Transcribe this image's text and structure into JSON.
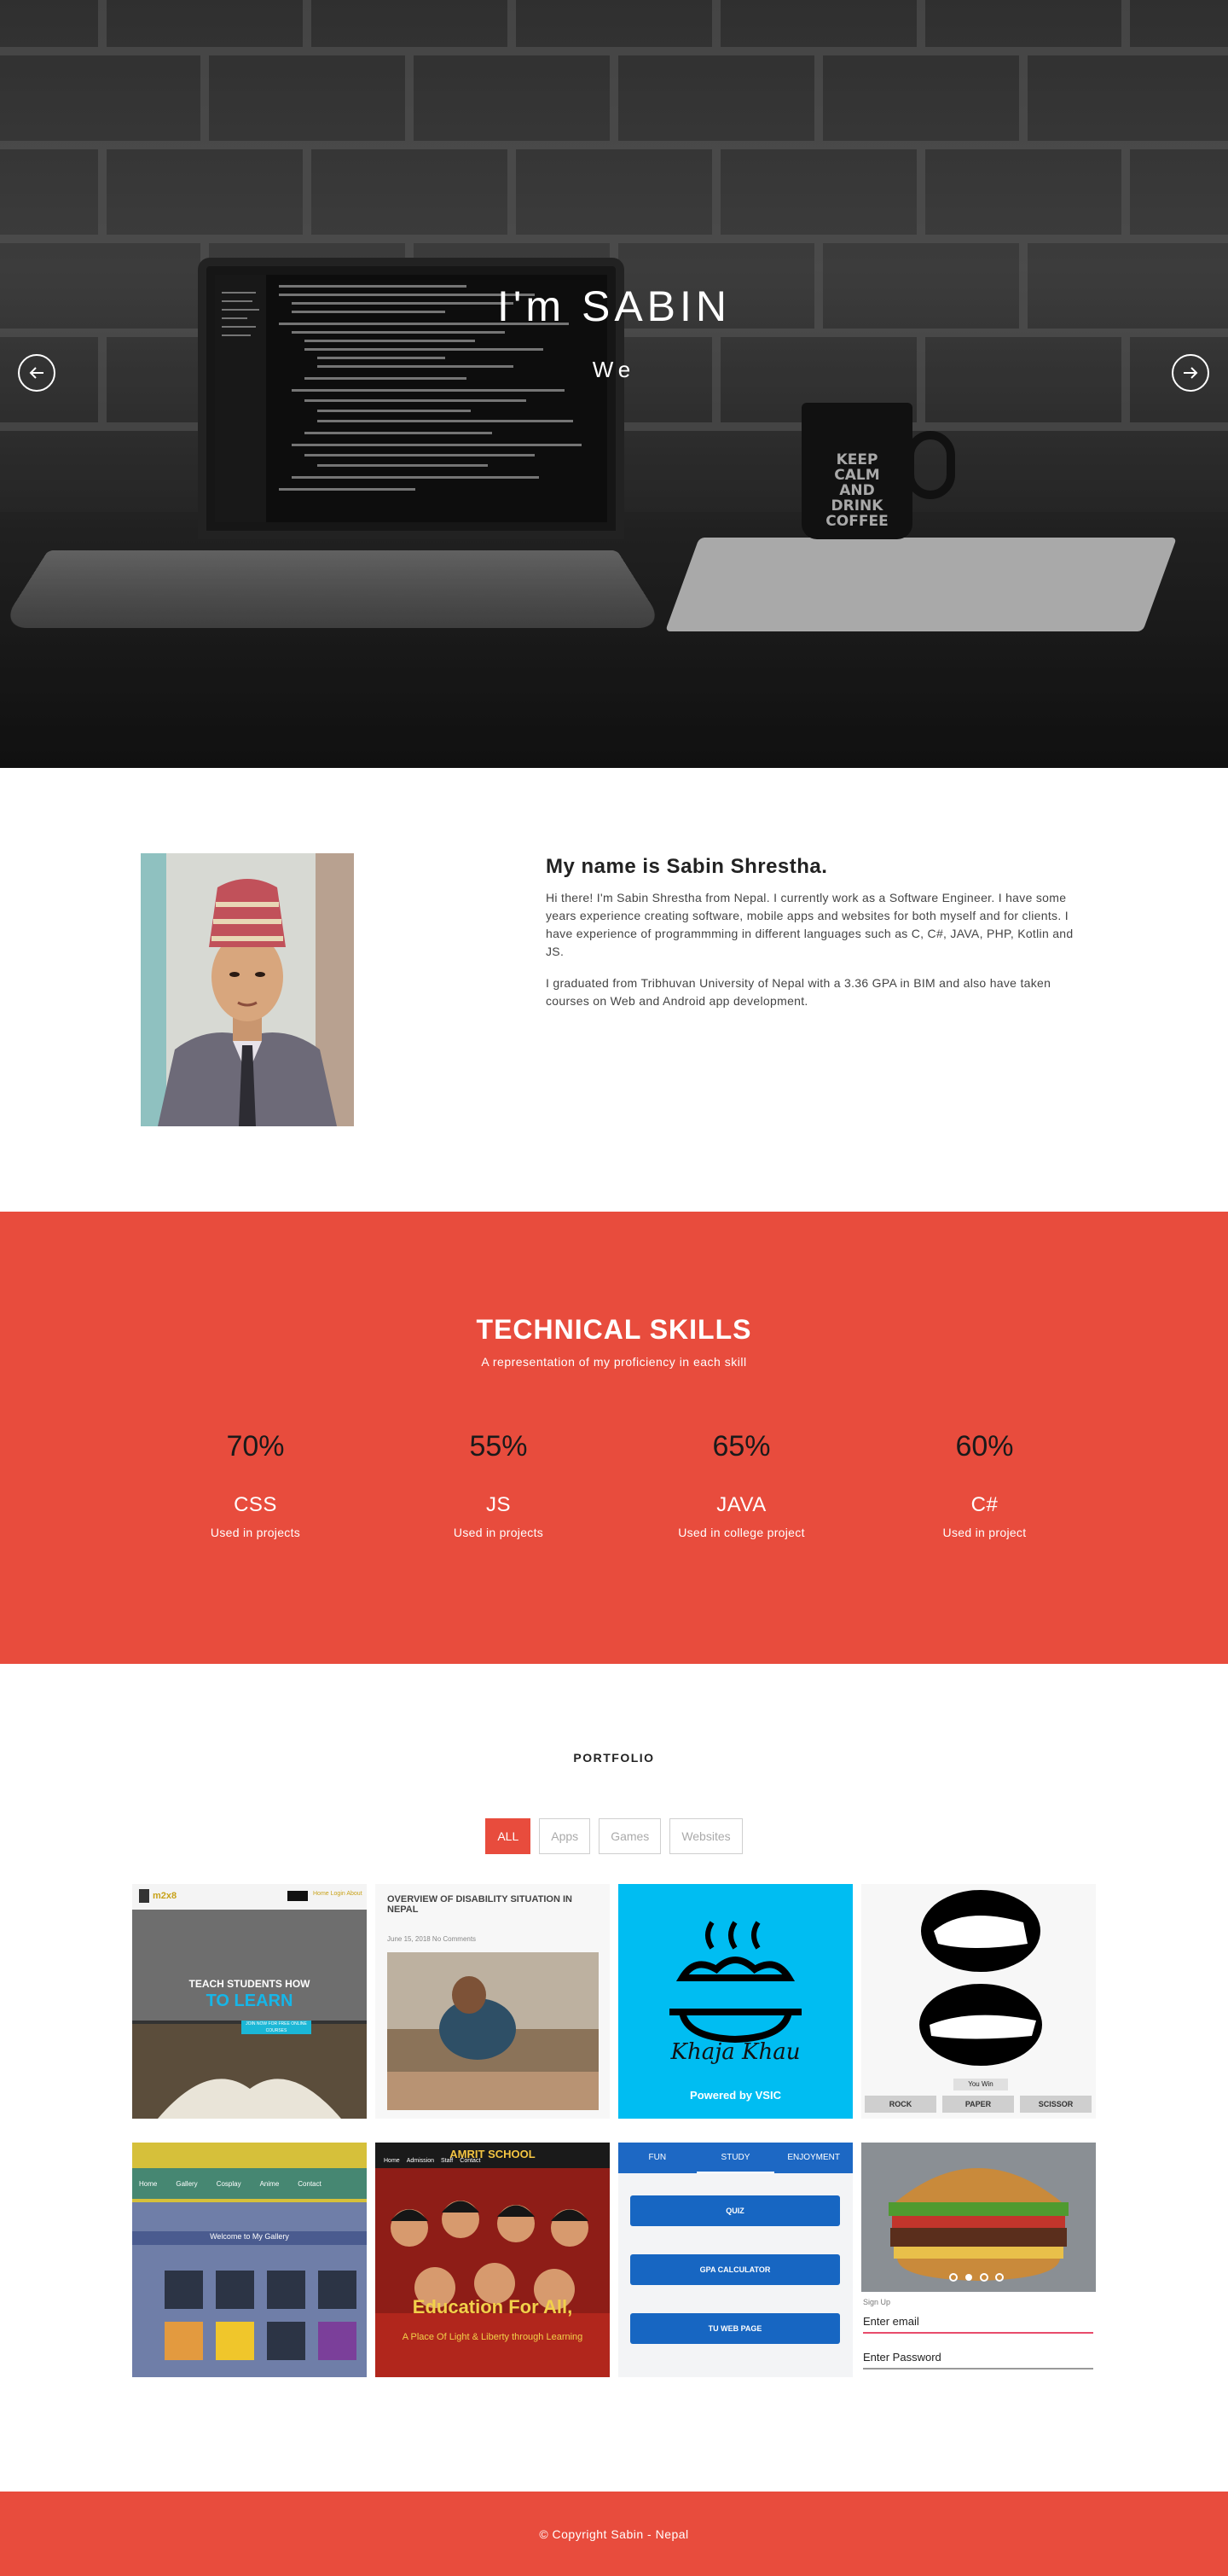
{
  "hero": {
    "title": "I'm SABIN",
    "subtitle": "We",
    "mug_text": "KEEP CALM AND DRINK COFFEE",
    "prev_icon": "arrow-left-circle-icon",
    "next_icon": "arrow-right-circle-icon"
  },
  "about": {
    "heading": "My name is Sabin Shrestha.",
    "paragraphs": [
      "Hi there! I'm Sabin Shrestha from Nepal. I currently work as a Software Engineer. I have some years experience creating software, mobile apps and websites for both myself and for clients. I have experience of programmming in different languages such as C, C#, JAVA, PHP, Kotlin and JS.",
      "I graduated from Tribhuvan University of Nepal with a 3.36 GPA in BIM and also have taken courses on Web and Android app development."
    ]
  },
  "skills": {
    "title": "TECHNICAL SKILLS",
    "subtitle": "A representation of my proficiency in each skill",
    "items": [
      {
        "percent": "70%",
        "name": "CSS",
        "desc": "Used in projects"
      },
      {
        "percent": "55%",
        "name": "JS",
        "desc": "Used in projects"
      },
      {
        "percent": "65%",
        "name": "JAVA",
        "desc": "Used in college project"
      },
      {
        "percent": "60%",
        "name": "C#",
        "desc": "Used in project"
      }
    ]
  },
  "portfolio": {
    "title": "PORTFOLIO",
    "filters": [
      "ALL",
      "Apps",
      "Games",
      "Websites"
    ],
    "active_filter": "ALL",
    "items": [
      {
        "logo": "m2x8",
        "nav": [
          "Home",
          "Login",
          "About"
        ],
        "headline": "TEACH STUDENTS HOW",
        "headline2": "TO LEARN",
        "cta": "JOIN NOW FOR FREE ONLINE COURSES"
      },
      {
        "headline": "OVERVIEW OF DISABILITY SITUATION IN NEPAL",
        "meta": "June 15, 2018 No Comments"
      },
      {
        "brand": "Khaja Khau",
        "tagline": "Powered by VSIC"
      },
      {
        "status": "You Win",
        "buttons": [
          "ROCK",
          "PAPER",
          "SCISSOR"
        ]
      },
      {
        "nav": [
          "Home",
          "Gallery",
          "Cosplay",
          "Anime",
          "Contact"
        ],
        "banner": "Welcome to My Gallery"
      },
      {
        "logo": "AMRIT SCHOOL",
        "nav": [
          "Home",
          "Admission",
          "Staff",
          "Contact"
        ],
        "headline": "Education For All,",
        "tagline": "A Place Of Light & Liberty through Learning"
      },
      {
        "tabs": [
          "FUN",
          "STUDY",
          "ENJOYMENT"
        ],
        "buttons": [
          "QUIZ",
          "GPA CALCULATOR",
          "TU WEB PAGE"
        ]
      },
      {
        "section": "Sign Up",
        "email_placeholder": "Enter email",
        "password_placeholder": "Enter Password"
      }
    ]
  },
  "footer": {
    "text": "© Copyright Sabin - Nepal"
  },
  "colors": {
    "accent": "#e84c3d",
    "cyan_tile": "#00bdf2",
    "app_button_blue": "#1766c2"
  }
}
